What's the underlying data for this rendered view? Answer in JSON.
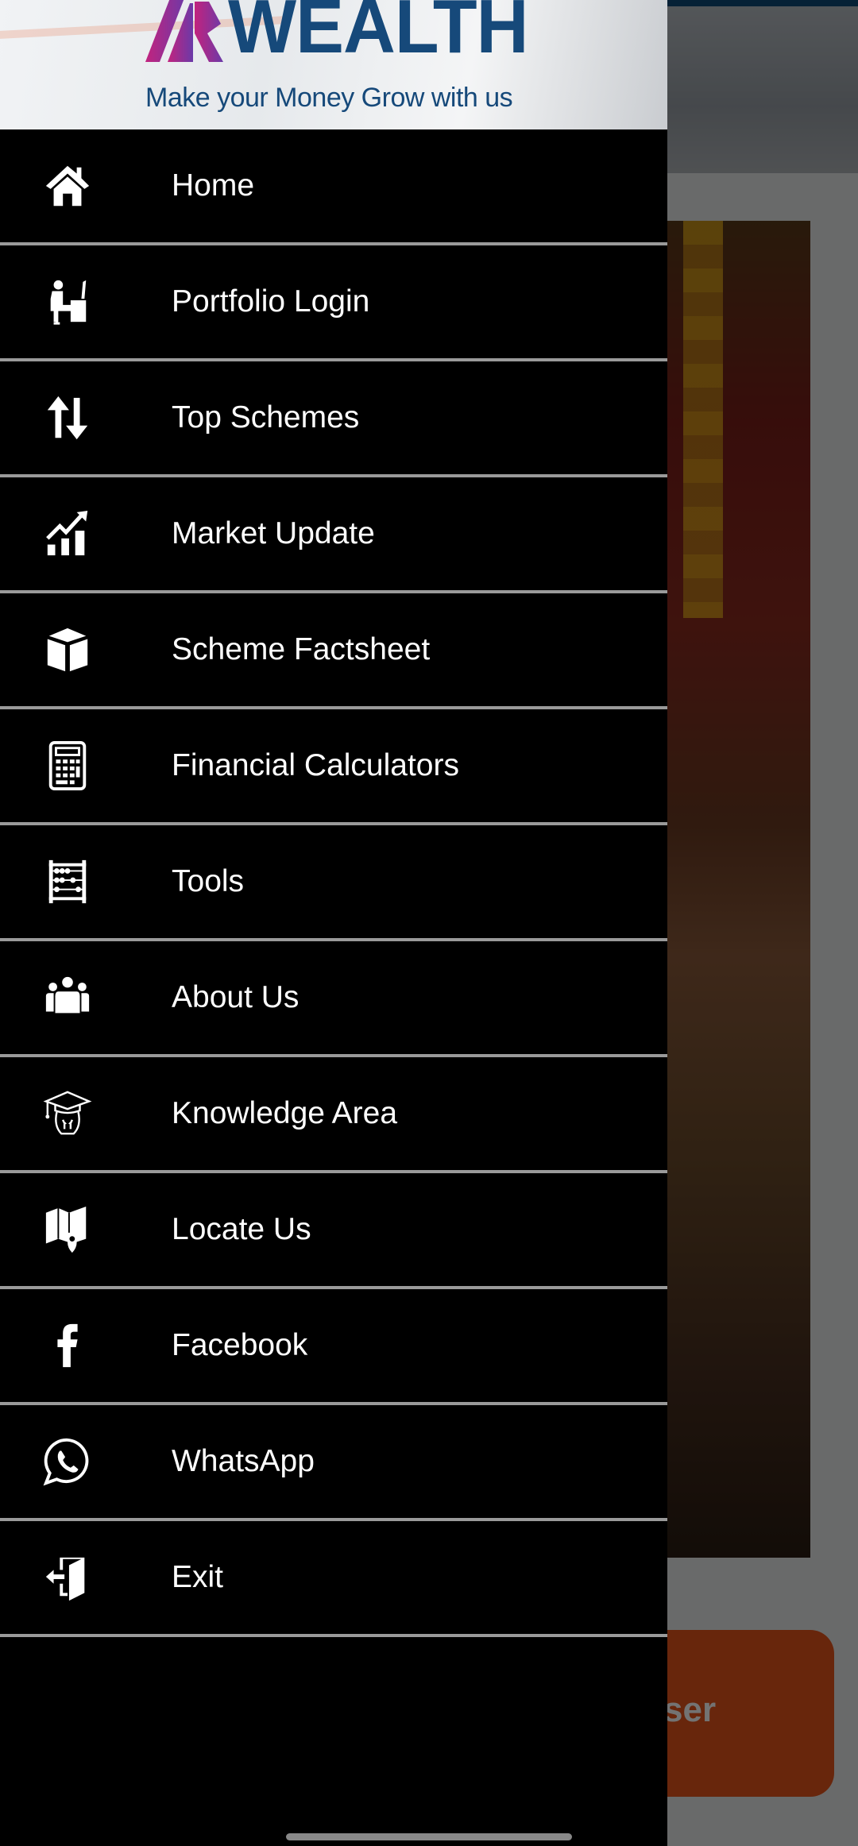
{
  "brand": {
    "name": "WEALTH",
    "mark": "AR",
    "tagline": "Make your Money Grow with us",
    "colors": {
      "primary": "#16497a",
      "mark_start": "#c2237e",
      "mark_end": "#6b3aa8"
    }
  },
  "drawer": {
    "items": [
      {
        "label": "Home",
        "icon": "home-icon"
      },
      {
        "label": "Portfolio Login",
        "icon": "person-at-desk-icon"
      },
      {
        "label": "Top Schemes",
        "icon": "sort-arrows-icon"
      },
      {
        "label": "Market Update",
        "icon": "chart-growth-icon"
      },
      {
        "label": "Scheme Factsheet",
        "icon": "cube-icon"
      },
      {
        "label": "Financial Calculators",
        "icon": "calculator-icon"
      },
      {
        "label": "Tools",
        "icon": "abacus-icon"
      },
      {
        "label": "About Us",
        "icon": "group-icon"
      },
      {
        "label": "Knowledge Area",
        "icon": "graduate-icon"
      },
      {
        "label": "Locate Us",
        "icon": "map-pin-icon"
      },
      {
        "label": "Facebook",
        "icon": "facebook-icon"
      },
      {
        "label": "WhatsApp",
        "icon": "whatsapp-icon"
      },
      {
        "label": "Exit",
        "icon": "exit-door-icon"
      }
    ]
  },
  "background": {
    "button_label_fragment": "ser",
    "button_color": "#e6561c",
    "topbar_color": "#0f4a78"
  }
}
